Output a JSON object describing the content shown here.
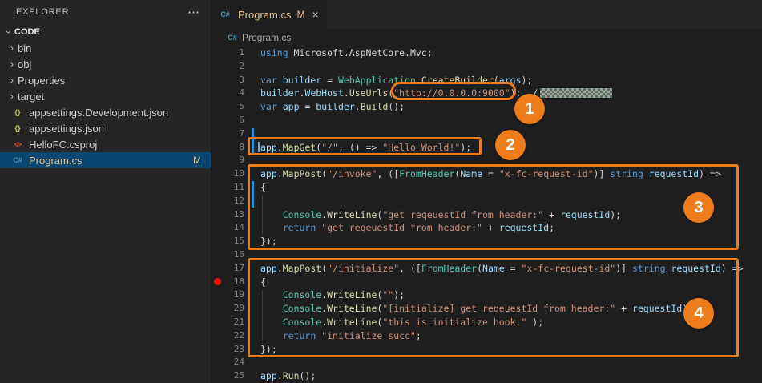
{
  "sidebar": {
    "title": "EXPLORER",
    "more_icon": "⋯",
    "section": "CODE",
    "chevron": "›",
    "folders": [
      "bin",
      "obj",
      "Properties",
      "target"
    ],
    "files": [
      {
        "name": "appsettings.Development.json",
        "icon": "json"
      },
      {
        "name": "appsettings.json",
        "icon": "json"
      },
      {
        "name": "HelloFC.csproj",
        "icon": "csproj"
      },
      {
        "name": "Program.cs",
        "icon": "cs",
        "badge": "M",
        "selected": true
      }
    ],
    "icon_glyphs": {
      "json": "{}",
      "csproj": "</>",
      "cs": "C#"
    }
  },
  "tab": {
    "label": "Program.cs",
    "modified": "M",
    "close": "×"
  },
  "breadcrumb": {
    "file": "Program.cs"
  },
  "editor": {
    "lines": [
      [
        [
          "k",
          "using"
        ],
        [
          "p",
          " Microsoft.AspNetCore.Mvc;"
        ]
      ],
      [],
      [
        [
          "k",
          "var"
        ],
        [
          "p",
          " "
        ],
        [
          "v",
          "builder"
        ],
        [
          "p",
          " = "
        ],
        [
          "t",
          "WebApplication"
        ],
        [
          "p",
          "."
        ],
        [
          "m",
          "CreateBuilder"
        ],
        [
          "p",
          "("
        ],
        [
          "v",
          "args"
        ],
        [
          "p",
          ");"
        ]
      ],
      [
        [
          "v",
          "builder"
        ],
        [
          "p",
          "."
        ],
        [
          "v",
          "WebHost"
        ],
        [
          "p",
          "."
        ],
        [
          "m",
          "UseUrls"
        ],
        [
          "p",
          "("
        ],
        [
          "s",
          "\"http://0.0.0.0:9000\""
        ],
        [
          "p",
          ");"
        ],
        [
          "p",
          "  /"
        ],
        [
          "blur",
          ""
        ]
      ],
      [
        [
          "k",
          "var"
        ],
        [
          "p",
          " "
        ],
        [
          "v",
          "app"
        ],
        [
          "p",
          " = "
        ],
        [
          "v",
          "builder"
        ],
        [
          "p",
          "."
        ],
        [
          "m",
          "Build"
        ],
        [
          "p",
          "();"
        ]
      ],
      [],
      [],
      [
        [
          "v",
          "app"
        ],
        [
          "p",
          "."
        ],
        [
          "m",
          "MapGet"
        ],
        [
          "p",
          "("
        ],
        [
          "s",
          "\"/\""
        ],
        [
          "p",
          ", () => "
        ],
        [
          "s",
          "\"Hello World!\""
        ],
        [
          "p",
          ");"
        ]
      ],
      [],
      [
        [
          "v",
          "app"
        ],
        [
          "p",
          "."
        ],
        [
          "m",
          "MapPost"
        ],
        [
          "p",
          "("
        ],
        [
          "s",
          "\"/invoke\""
        ],
        [
          "p",
          ", (["
        ],
        [
          "t",
          "FromHeader"
        ],
        [
          "p",
          "("
        ],
        [
          "v",
          "Name"
        ],
        [
          "p",
          " = "
        ],
        [
          "s",
          "\"x-fc-request-id\""
        ],
        [
          "p",
          ")] "
        ],
        [
          "k",
          "string"
        ],
        [
          "p",
          " "
        ],
        [
          "v",
          "requestId"
        ],
        [
          "p",
          ") =>"
        ]
      ],
      [
        [
          "p",
          "{"
        ]
      ],
      [],
      [
        [
          "p",
          "    "
        ],
        [
          "t",
          "Console"
        ],
        [
          "p",
          "."
        ],
        [
          "m",
          "WriteLine"
        ],
        [
          "p",
          "("
        ],
        [
          "s",
          "\"get reqeuestId from header:\""
        ],
        [
          "p",
          " + "
        ],
        [
          "v",
          "requestId"
        ],
        [
          "p",
          ");"
        ]
      ],
      [
        [
          "p",
          "    "
        ],
        [
          "k",
          "return"
        ],
        [
          "p",
          " "
        ],
        [
          "s",
          "\"get reqeuestId from header:\""
        ],
        [
          "p",
          " + "
        ],
        [
          "v",
          "requestId"
        ],
        [
          "p",
          ";"
        ]
      ],
      [
        [
          "p",
          "});"
        ]
      ],
      [],
      [
        [
          "v",
          "app"
        ],
        [
          "p",
          "."
        ],
        [
          "m",
          "MapPost"
        ],
        [
          "p",
          "("
        ],
        [
          "s",
          "\"/initialize\""
        ],
        [
          "p",
          ", (["
        ],
        [
          "t",
          "FromHeader"
        ],
        [
          "p",
          "("
        ],
        [
          "v",
          "Name"
        ],
        [
          "p",
          " = "
        ],
        [
          "s",
          "\"x-fc-request-id\""
        ],
        [
          "p",
          ")] "
        ],
        [
          "k",
          "string"
        ],
        [
          "p",
          " "
        ],
        [
          "v",
          "requestId"
        ],
        [
          "p",
          ") =>"
        ]
      ],
      [
        [
          "p",
          "{"
        ]
      ],
      [
        [
          "p",
          "    "
        ],
        [
          "t",
          "Console"
        ],
        [
          "p",
          "."
        ],
        [
          "m",
          "WriteLine"
        ],
        [
          "p",
          "("
        ],
        [
          "s",
          "\"\""
        ],
        [
          "p",
          ");"
        ]
      ],
      [
        [
          "p",
          "    "
        ],
        [
          "t",
          "Console"
        ],
        [
          "p",
          "."
        ],
        [
          "m",
          "WriteLine"
        ],
        [
          "p",
          "("
        ],
        [
          "s",
          "\"[initialize] get reqeuestId from header:\""
        ],
        [
          "p",
          " + "
        ],
        [
          "v",
          "requestId"
        ],
        [
          "p",
          ");"
        ]
      ],
      [
        [
          "p",
          "    "
        ],
        [
          "t",
          "Console"
        ],
        [
          "p",
          "."
        ],
        [
          "m",
          "WriteLine"
        ],
        [
          "p",
          "("
        ],
        [
          "s",
          "\"this is initialize hook.\""
        ],
        [
          "p",
          " );"
        ]
      ],
      [
        [
          "p",
          "    "
        ],
        [
          "k",
          "return"
        ],
        [
          "p",
          " "
        ],
        [
          "s",
          "\"initialize succ\""
        ],
        [
          "p",
          ";"
        ]
      ],
      [
        [
          "p",
          "});"
        ]
      ],
      [],
      [
        [
          "v",
          "app"
        ],
        [
          "p",
          "."
        ],
        [
          "m",
          "Run"
        ],
        [
          "p",
          "();"
        ]
      ]
    ]
  },
  "annotations": {
    "accent": "#ee7c1b",
    "badges": [
      "1",
      "2",
      "3",
      "4"
    ]
  }
}
